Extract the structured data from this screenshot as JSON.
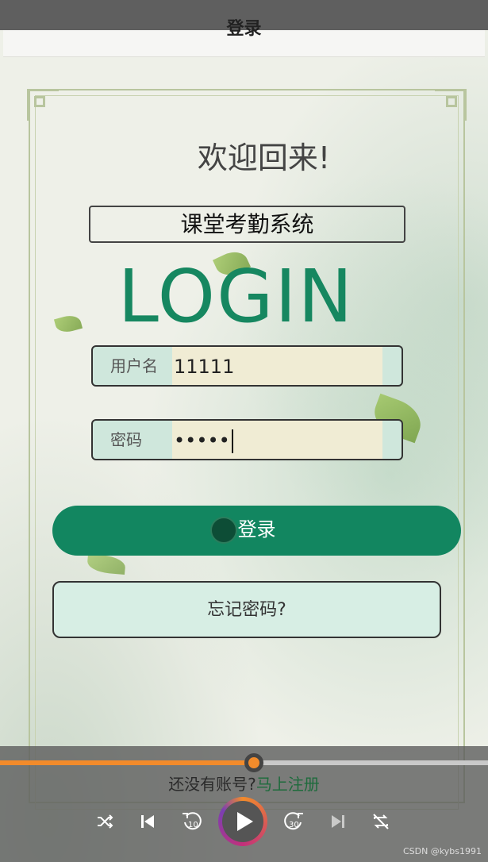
{
  "header": {
    "title": "登录"
  },
  "welcome": "欢迎回来!",
  "system_name": "课堂考勤系统",
  "logo_text": "LOGIN",
  "form": {
    "username_label": "用户名",
    "username_value": "11111",
    "password_label": "密码",
    "password_value": "•••••"
  },
  "buttons": {
    "login": "登录",
    "forgot": "忘记密码?"
  },
  "register": {
    "prompt": "还没有账号?",
    "link": "马上注册"
  },
  "player": {
    "progress_fraction": 0.52,
    "rewind_label": "10",
    "forward_label": "30",
    "icons": [
      "shuffle-icon",
      "previous-icon",
      "rewind-10-icon",
      "play-icon",
      "forward-30-icon",
      "next-icon",
      "repeat-off-icon"
    ]
  },
  "watermark": "CSDN @kybs1991",
  "colors": {
    "primary": "#128660",
    "accent": "#f28b2b",
    "input_bg": "#f0ecd4"
  }
}
